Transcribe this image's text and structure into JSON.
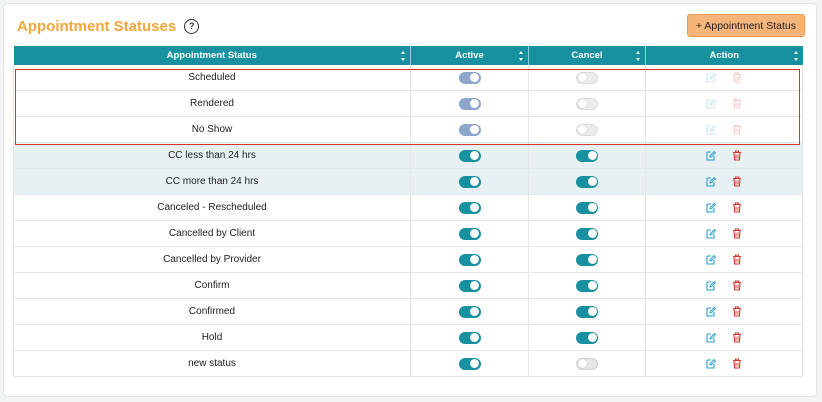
{
  "header": {
    "title": "Appointment Statuses",
    "help_glyph": "?",
    "add_button_label": "+ Appointment Status"
  },
  "table": {
    "columns": [
      "Appointment Status",
      "Active",
      "Cancel",
      "Action"
    ],
    "rows": [
      {
        "name": "Scheduled",
        "active": true,
        "cancel": false,
        "locked": true
      },
      {
        "name": "Rendered",
        "active": true,
        "cancel": false,
        "locked": true
      },
      {
        "name": "No Show",
        "active": true,
        "cancel": false,
        "locked": true
      },
      {
        "name": "CC less than 24 hrs",
        "active": true,
        "cancel": true,
        "locked": false
      },
      {
        "name": "CC more than 24 hrs",
        "active": true,
        "cancel": true,
        "locked": false
      },
      {
        "name": "Canceled - Rescheduled",
        "active": true,
        "cancel": true,
        "locked": false
      },
      {
        "name": "Cancelled by Client",
        "active": true,
        "cancel": true,
        "locked": false
      },
      {
        "name": "Cancelled by Provider",
        "active": true,
        "cancel": true,
        "locked": false
      },
      {
        "name": "Confirm",
        "active": true,
        "cancel": true,
        "locked": false
      },
      {
        "name": "Confirmed",
        "active": true,
        "cancel": true,
        "locked": false
      },
      {
        "name": "Hold",
        "active": true,
        "cancel": true,
        "locked": false
      },
      {
        "name": "new status",
        "active": true,
        "cancel": false,
        "locked": false
      }
    ]
  },
  "colors": {
    "title": "#f5a63a",
    "header_bg": "#17919f",
    "toggle_on": "#17919f",
    "edit_icon": "#2a9fc7",
    "delete_icon": "#d9352e",
    "highlight_border": "#d9352e"
  }
}
